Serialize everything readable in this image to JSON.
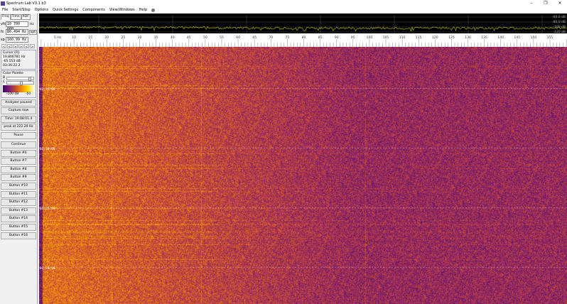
{
  "window": {
    "title": "Spectrum Lab V3.1 b3",
    "minimize": "–",
    "maximize": "❐",
    "close": "✕"
  },
  "menu": [
    "File",
    "Start/Stop",
    "Options",
    "Quick Settings",
    "Components",
    "View/Windows",
    "Help"
  ],
  "left": {
    "tabs": [
      "Freq",
      "Time",
      "RDF"
    ],
    "vfo": {
      "label": "vfo",
      "value": "10 700 000",
      "unit": "Hz"
    },
    "fc": {
      "label": "fc",
      "value": "80.494 Hz",
      "button": "opt"
    },
    "sp": {
      "label": "sp",
      "value": "160.99 Hz"
    },
    "arrows": [
      "<",
      "<",
      ">",
      ">",
      "<",
      ">"
    ],
    "cursor": {
      "title": "Cursor [R]",
      "freq": "19.806781 Hz",
      "level": "-65.553 dB",
      "time": "03:36:22.2"
    },
    "palette": {
      "title": "Color Palette",
      "b": "B",
      "c": "C",
      "min": "-100 dB",
      "max": "-50",
      "b_level": 0.75,
      "c_level": 0.45
    },
    "buttons": [
      "Analyzer paused",
      "Capture now",
      "Time:  19:08:01.4",
      "peak at 222.29 Hz",
      "Pause",
      "Continue",
      "Button #6",
      "Button #7",
      "Button #8",
      "Button #9",
      "Button #10",
      "Button #11",
      "Button #12",
      "Button #13",
      "Button #14",
      "Button #15",
      "Button #16"
    ]
  },
  "spectrum": {
    "db_labels": [
      "-60.0 dB",
      "-80.0 dB",
      "-100 dB",
      "-120 dB"
    ],
    "trace_color": "#c8c800"
  },
  "freq_scale": {
    "labels": [
      "5 Hz",
      "10",
      "15",
      "20",
      "25",
      "30",
      "35",
      "40",
      "45",
      "50",
      "55",
      "60",
      "65",
      "70",
      "75",
      "80",
      "85",
      "90",
      "95",
      "100",
      "105",
      "110",
      "115",
      "120",
      "125",
      "130",
      "135",
      "140",
      "145",
      "150",
      "155"
    ]
  },
  "waterfall": {
    "time_labels": [
      "03:35:00",
      "03:30:00",
      "03:25:00",
      "03:20:00"
    ]
  }
}
